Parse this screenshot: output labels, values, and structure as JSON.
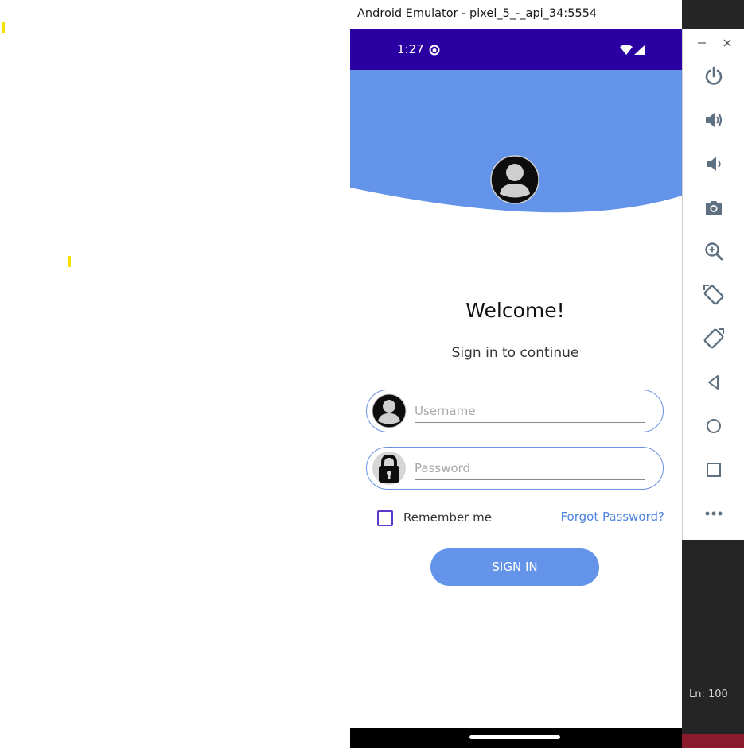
{
  "window": {
    "title": "Android Emulator - pixel_5_-_api_34:5554"
  },
  "status_bar": {
    "time": "1:27"
  },
  "login": {
    "title": "Welcome!",
    "subtitle": "Sign in to continue",
    "username_placeholder": "Username",
    "password_placeholder": "Password",
    "remember_label": "Remember me",
    "remember_checked": false,
    "forgot_label": "Forgot Password?",
    "signin_label": "SIGN IN"
  },
  "editor": {
    "line_indicator": "Ln: 100"
  },
  "colors": {
    "status_bar": "#2a00a2",
    "header": "#6494ea",
    "accent_link": "#4f84e0",
    "checkbox": "#5b39c9"
  },
  "sidebar": {
    "window_controls": [
      "minimize-icon",
      "close-icon"
    ],
    "tools": [
      "power-icon",
      "volume-up-icon",
      "volume-down-icon",
      "camera-icon",
      "zoom-icon",
      "rotate-left-icon",
      "rotate-right-icon",
      "back-icon",
      "home-icon",
      "overview-icon",
      "more-icon"
    ]
  }
}
